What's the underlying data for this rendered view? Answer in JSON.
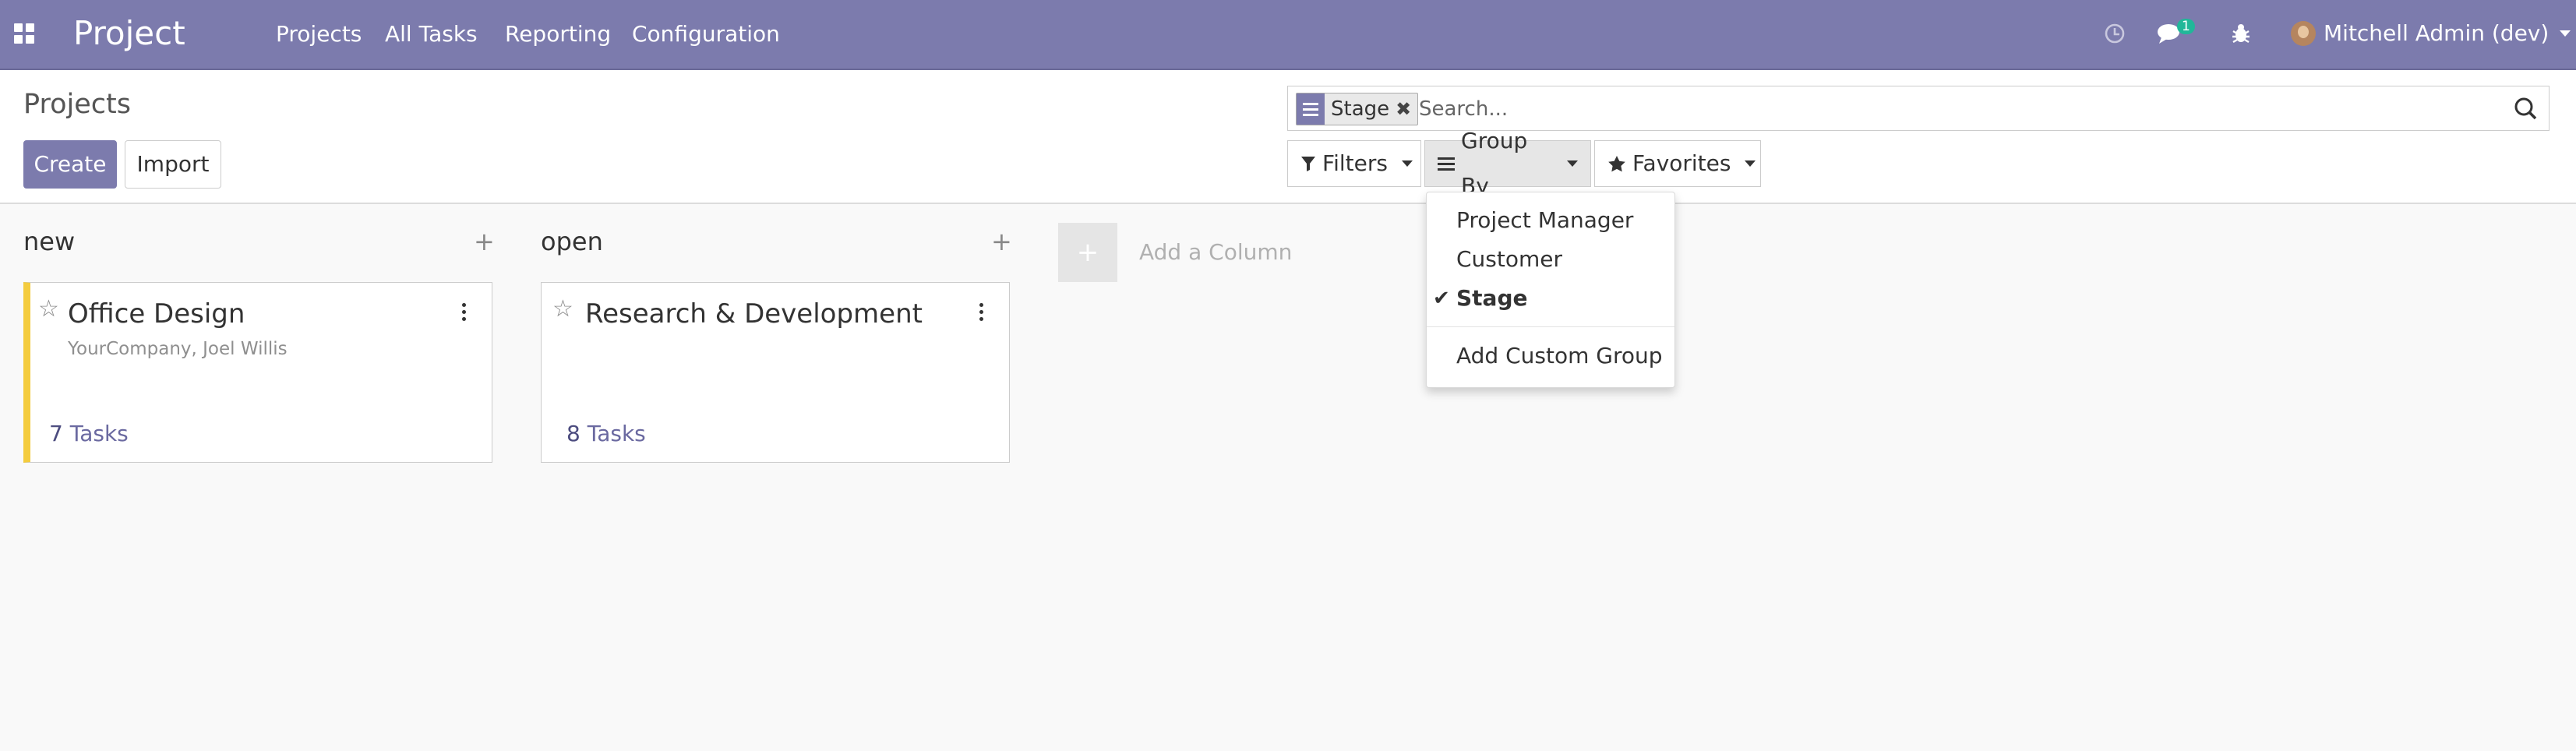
{
  "navbar": {
    "brand": "Project",
    "menu": [
      "Projects",
      "All Tasks",
      "Reporting",
      "Configuration"
    ],
    "message_count": "1",
    "user": "Mitchell Admin (dev)",
    "icons": [
      "apps-grid-icon",
      "clock-icon",
      "chat-icon",
      "bug-icon"
    ],
    "bg_color": "#7c7bad"
  },
  "control_panel": {
    "breadcrumb": "Projects",
    "create_label": "Create",
    "import_label": "Import",
    "search": {
      "facet": "Stage",
      "placeholder": "Search..."
    },
    "filters_label": "Filters",
    "group_by_label": "Group By",
    "favorites_label": "Favorites"
  },
  "group_by_menu": {
    "items": [
      {
        "label": "Project Manager",
        "selected": false
      },
      {
        "label": "Customer",
        "selected": false
      },
      {
        "label": "Stage",
        "selected": true
      }
    ],
    "custom_label": "Add Custom Group"
  },
  "kanban": {
    "columns": [
      {
        "title": "new",
        "cards": [
          {
            "title": "Office Design",
            "subtitle": "YourCompany, Joel Willis",
            "task_count": "7",
            "task_label": "Tasks",
            "accent_color": "#f4cc3e"
          }
        ]
      },
      {
        "title": "open",
        "cards": [
          {
            "title": "Research & Development",
            "subtitle": "",
            "task_count": "8",
            "task_label": "Tasks"
          }
        ]
      }
    ],
    "add_column_label": "Add a Column"
  }
}
